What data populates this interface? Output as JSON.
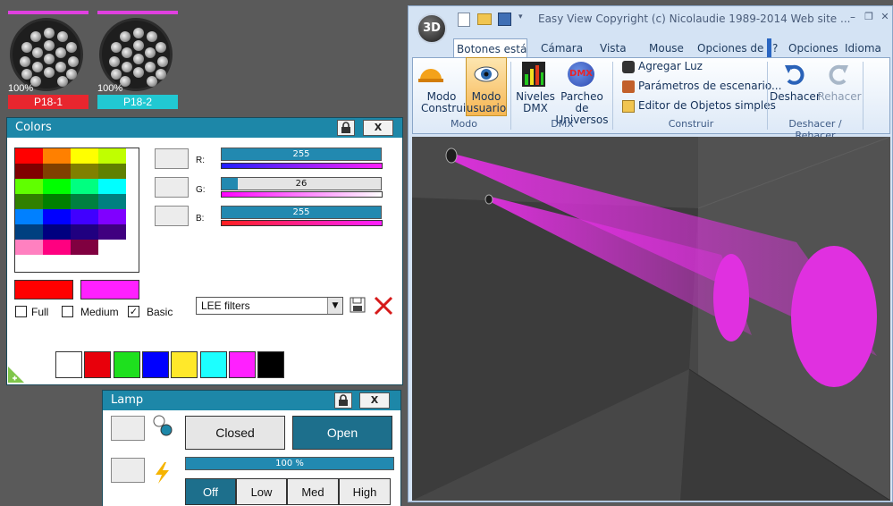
{
  "fixtures": [
    {
      "percent": "100%",
      "label": "P18-1",
      "label_color": "#e8262e"
    },
    {
      "percent": "100%",
      "label": "P18-2",
      "label_color": "#21c8d2"
    }
  ],
  "colors_panel": {
    "title": "Colors",
    "lock_icon": "lock-icon",
    "close_label": "X",
    "grid_colors": [
      "#ff0000",
      "#ff8000",
      "#ffff00",
      "#c0ff00",
      "#800000",
      "#804000",
      "#808000",
      "#608000",
      "#60ff00",
      "#00ff00",
      "#00ff80",
      "#00ffff",
      "#308000",
      "#008000",
      "#008040",
      "#008080",
      "#0080ff",
      "#0000ff",
      "#4000ff",
      "#8000ff",
      "#004080",
      "#000080",
      "#200080",
      "#400080",
      "#ff80c0",
      "#ff0080",
      "#800040",
      "#ffffff"
    ],
    "current_color": "#ff0000",
    "target_color": "#ff20ff",
    "rgb": {
      "r_label": "R:",
      "g_label": "G:",
      "b_label": "B:",
      "r": "255",
      "g": "26",
      "b": "255",
      "r_fraction": 1.0,
      "g_fraction": 0.1,
      "b_fraction": 1.0
    },
    "modes": {
      "full": "Full",
      "medium": "Medium",
      "basic": "Basic",
      "basic_checked": "✓"
    },
    "filter_select": {
      "value": "LEE filters"
    },
    "palette": [
      "#ffffff",
      "#e8000b",
      "#1ee01e",
      "#0000ff",
      "#ffe82a",
      "#1cffff",
      "#ff20ff",
      "#000000"
    ]
  },
  "lamp_panel": {
    "title": "Lamp",
    "close_label": "X",
    "closed_label": "Closed",
    "open_label": "Open",
    "dimmer_label": "100 %",
    "dimmer_fraction": 1.0,
    "levels": [
      "Off",
      "Low",
      "Med",
      "High"
    ]
  },
  "app": {
    "logo": "3D",
    "title": "Easy View   Copyright (c) Nicolaudie 1989-2014    Web site ...",
    "window_controls": {
      "minimize": "–",
      "restore": "❐",
      "close": "✕"
    },
    "tabs": [
      "Botones estánd",
      "Cámara",
      "Vista",
      "Mouse",
      "Opciones de re"
    ],
    "help_tab": "?",
    "options_tab": "Opciones",
    "language_tab": "Idioma",
    "groups": {
      "modo": {
        "label": "Modo",
        "construir": "Modo Construir",
        "usuario": "Modo usuario"
      },
      "dmx": {
        "label": "DMX",
        "niveles": "Niveles DMX",
        "parcheo": "Parcheo de Universos",
        "dmx_badge": "DMX"
      },
      "construir": {
        "label": "Construir",
        "agregar": "Agregar Luz",
        "parametros": "Parámetros de escenario...",
        "editor": "Editor de Objetos simples"
      },
      "undo": {
        "label": "Deshacer / Rehacer",
        "deshacer": "Deshacer",
        "rehacer": "Rehacer"
      }
    },
    "beam_color": "#e030e0"
  }
}
